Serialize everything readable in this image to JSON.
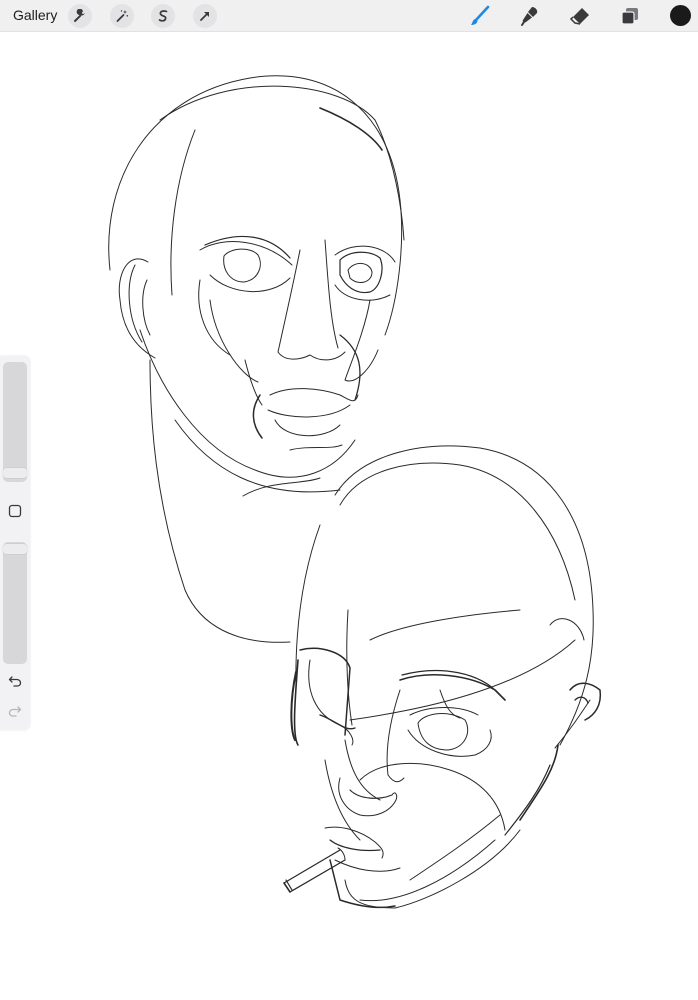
{
  "toolbar": {
    "gallery_label": "Gallery",
    "left_tools": [
      "wrench-icon",
      "magic-wand-icon",
      "selection-s-icon",
      "transform-arrow-icon"
    ],
    "right_tools": [
      "brush-icon",
      "smudge-icon",
      "eraser-icon",
      "layers-icon"
    ],
    "active_tool": "brush-icon",
    "active_color": "#1a1a1a",
    "accent_color": "#1e88e5"
  },
  "sidebar": {
    "brush_size_level": 0.96,
    "brush_opacity_level": 0.02,
    "modify_button_icon": "square-icon",
    "undo_icon": "undo-icon",
    "redo_icon": "redo-icon",
    "redo_enabled": false
  },
  "canvas": {
    "content": "sketch-two-heads"
  }
}
